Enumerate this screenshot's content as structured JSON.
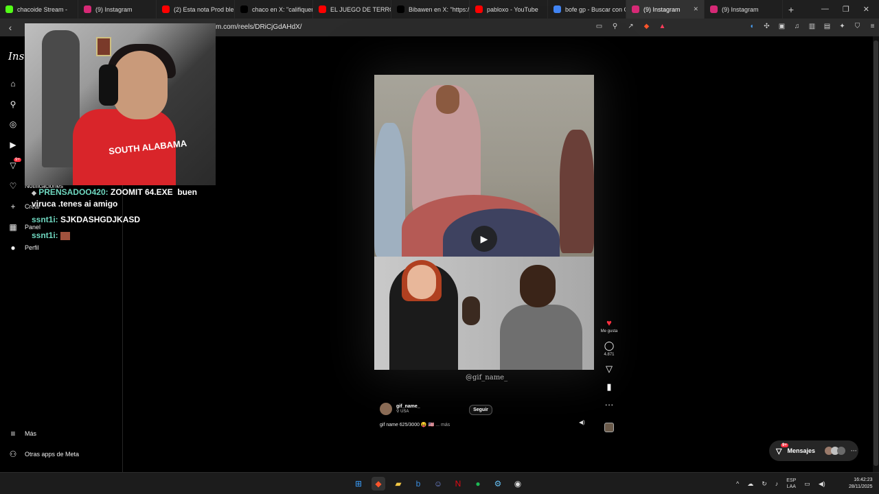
{
  "browser": {
    "tabs": [
      {
        "title": "chacoide Stream -",
        "fav_color": "#53fc18"
      },
      {
        "title": "(9) Instagram",
        "fav_color": "#d62976"
      },
      {
        "title": "(2) Esta nota Prod ble:",
        "fav_color": "#ff0000"
      },
      {
        "title": "chaco en X: \"califiquen",
        "fav_color": "#000000"
      },
      {
        "title": "EL JUEGO DE TERROR",
        "fav_color": "#ff0000"
      },
      {
        "title": "Bibawen en X: \"https://",
        "fav_color": "#000000"
      },
      {
        "title": "pabloxo - YouTube",
        "fav_color": "#ff0000"
      },
      {
        "title": "bofe gp - Buscar con G",
        "fav_color": "#4285f4"
      },
      {
        "title": "(9) Instagram",
        "fav_color": "#d62976"
      },
      {
        "title": "(9) Instagram",
        "fav_color": "#d62976"
      }
    ],
    "url": "m.com/reels/DRiCjGdAHdX/"
  },
  "sidebar": {
    "logo": "Insta",
    "items": [
      {
        "icon": "home-icon",
        "glyph": "⌂"
      },
      {
        "icon": "search-icon",
        "glyph": "⚲"
      },
      {
        "icon": "explore-icon",
        "glyph": "◎"
      },
      {
        "icon": "reels-icon",
        "glyph": "▶"
      },
      {
        "icon": "messages-icon",
        "glyph": "▽"
      }
    ],
    "notifications": "Notificaciones",
    "create": "Crear",
    "panel": "Panel",
    "profile": "Perfil",
    "more": "Más",
    "meta_apps": "Otras apps de Meta"
  },
  "stream": {
    "shirt_text": "SOUTH ALABAMA",
    "chat": [
      {
        "user": "PRENSADOO420:",
        "text": "ZOOMIT 64.EXE  buen viruca .tenes ai amigo"
      },
      {
        "user": "ssnt1i:",
        "text": "SJKDASHGDJKASD"
      },
      {
        "user": "ssnt1i:",
        "text": ""
      }
    ]
  },
  "reel": {
    "watermark": "@gif_name_",
    "author": "gif_name_",
    "location": "USA",
    "follow": "Seguir",
    "caption": "gif name 625/3000 😝 🇺🇸",
    "caption_more": "... más",
    "likes_label": "Me gusta",
    "comments_count": "4.871",
    "heart_color": "#ff3040"
  },
  "messages": {
    "label": "Mensajes",
    "badge": "9+"
  },
  "notification_badge": "9+",
  "tray": {
    "lang": "ESP",
    "lang2": "LAA",
    "time": "16:42:23",
    "date": "28/11/2025"
  }
}
